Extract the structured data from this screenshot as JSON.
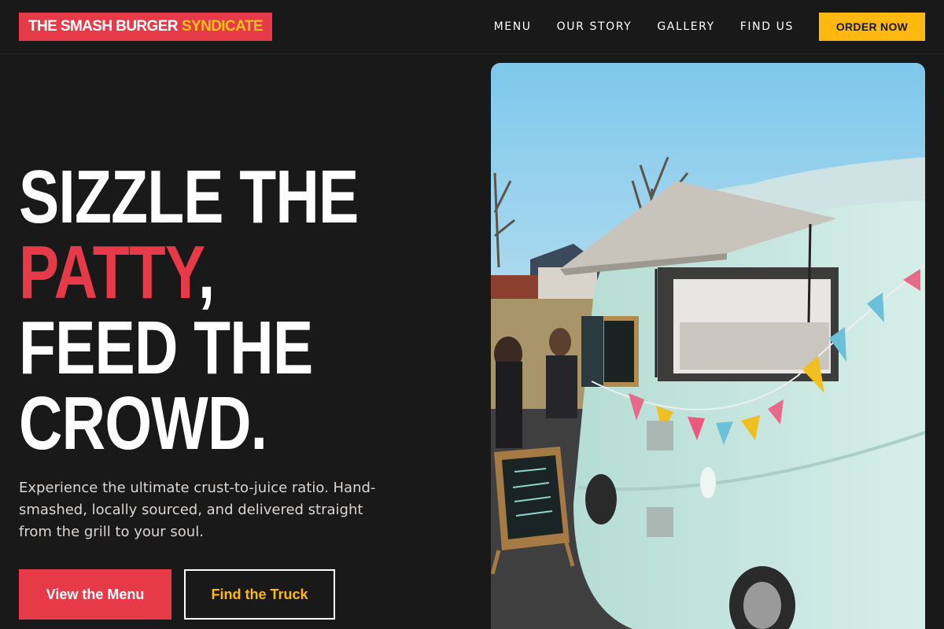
{
  "brand": {
    "name_white": "THE SMASH BURGER",
    "name_yellow": "SYNDICATE"
  },
  "nav": {
    "items": [
      "MENU",
      "OUR STORY",
      "GALLERY",
      "FIND US"
    ],
    "order_label": "ORDER NOW"
  },
  "hero": {
    "headline_line1": "SIZZLE THE",
    "headline_accent": "PATTY",
    "headline_comma": ",",
    "headline_line3": "FEED THE",
    "headline_line4": "CROWD.",
    "tagline": "Experience the ultimate crust-to-juice ratio. Hand-smashed, locally sourced, and delivered straight from the grill to your soul.",
    "primary_button": "View the Menu",
    "secondary_button": "Find the Truck",
    "image_subject": "food-truck-photo"
  },
  "colors": {
    "background": "#1a1919",
    "accent_red": "#e63a48",
    "accent_yellow": "#ffb80f",
    "text": "#ffffff"
  }
}
